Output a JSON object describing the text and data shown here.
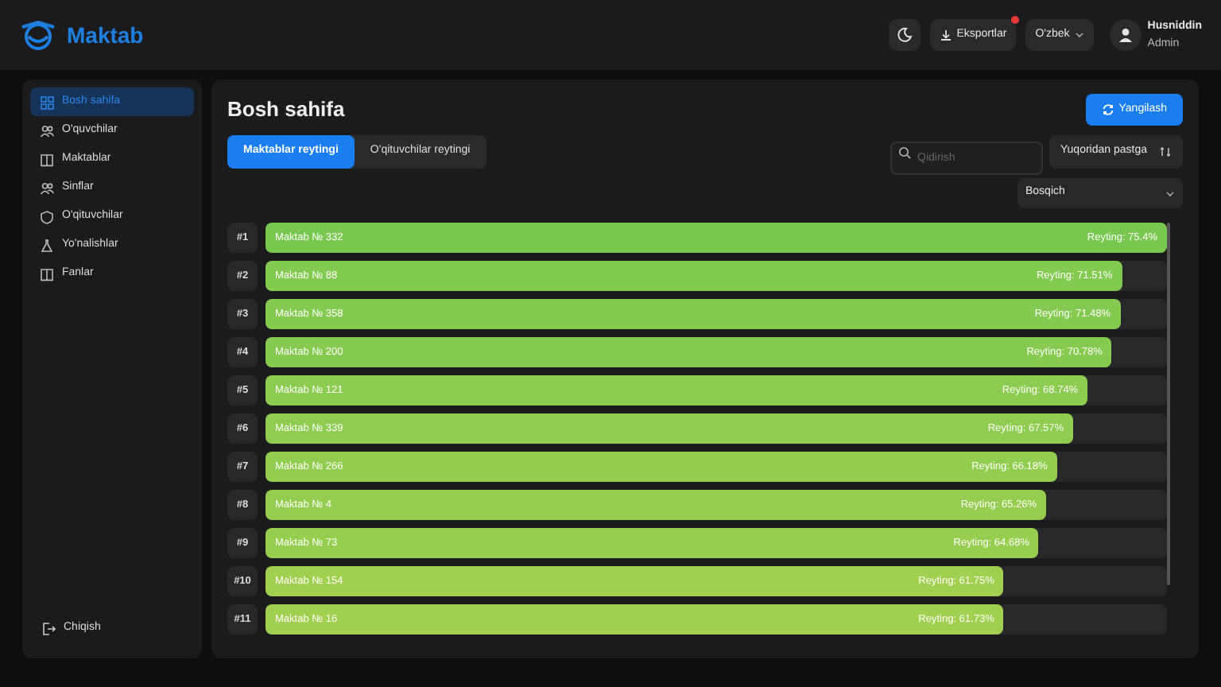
{
  "brand": "Maktab",
  "header": {
    "export": {
      "label": "Eksportlar",
      "notification": true
    },
    "language": "O'zbek",
    "user": {
      "name": "Husniddin",
      "role": "Admin"
    }
  },
  "sidebar": {
    "items": [
      {
        "label": "Bosh sahifa",
        "selected": true
      },
      {
        "label": "O'quvchilar",
        "selected": false
      },
      {
        "label": "Maktablar",
        "selected": false
      },
      {
        "label": "Sinflar",
        "selected": false
      },
      {
        "label": "O'qituvchilar",
        "selected": false
      },
      {
        "label": "Yo'nalishlar",
        "selected": false
      },
      {
        "label": "Fanlar",
        "selected": false
      }
    ],
    "logout": "Chiqish"
  },
  "main": {
    "title": "Bosh sahifa",
    "refresh": "Yangilash",
    "tabs": [
      {
        "label": "Maktablar reytingi",
        "selected": true
      },
      {
        "label": "O'qituvchilar reytingi",
        "selected": false
      }
    ],
    "search": {
      "placeholder": "Qidirish"
    },
    "sort": "Yuqoridan pastga",
    "stage_select": "Bosqich",
    "ranking": [
      {
        "rank": "#1",
        "name": "Maktab № 332",
        "reading": "Reyting: 75.4%",
        "level": 1.0
      },
      {
        "rank": "#2",
        "name": "Maktab № 88",
        "reading": "Reyting: 71.51%",
        "level": 0.95
      },
      {
        "rank": "#3",
        "name": "Maktab № 358",
        "reading": "Reyting: 71.48%",
        "level": 0.948
      },
      {
        "rank": "#4",
        "name": "Maktab № 200",
        "reading": "Reyting: 70.78%",
        "level": 0.939
      },
      {
        "rank": "#5",
        "name": "Maktab № 121",
        "reading": "Reyting: 68.74%",
        "level": 0.912
      },
      {
        "rank": "#6",
        "name": "Maktab № 339",
        "reading": "Reyting: 67.57%",
        "level": 0.896
      },
      {
        "rank": "#7",
        "name": "Maktab № 266",
        "reading": "Reyting: 66.18%",
        "level": 0.878
      },
      {
        "rank": "#8",
        "name": "Maktab № 4",
        "reading": "Reyting: 65.26%",
        "level": 0.866
      },
      {
        "rank": "#9",
        "name": "Maktab № 73",
        "reading": "Reyting: 64.68%",
        "level": 0.858
      },
      {
        "rank": "#10",
        "name": "Maktab № 154",
        "reading": "Reyting: 61.75%",
        "level": 0.819
      },
      {
        "rank": "#11",
        "name": "Maktab № 16",
        "reading": "Reyting: 61.73%",
        "level": 0.819
      }
    ]
  }
}
